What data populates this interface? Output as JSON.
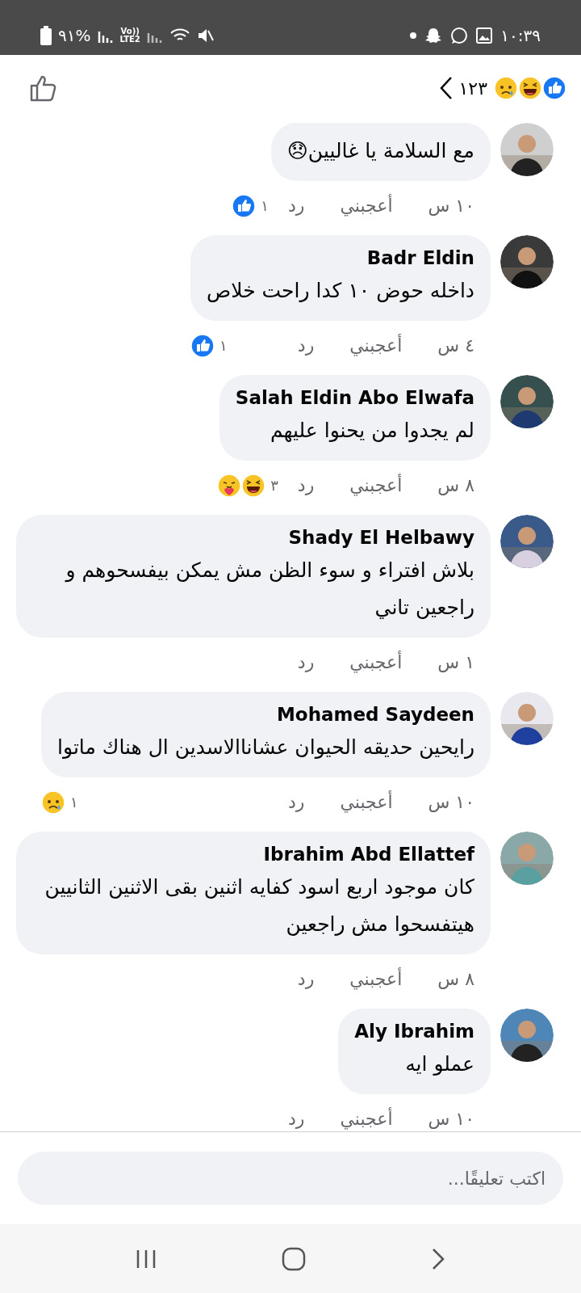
{
  "status_bar": {
    "time": "١٠:٣٩",
    "battery": "%٩١",
    "network_top": "Vo))",
    "network_bottom": "LTE2"
  },
  "header": {
    "reactions": [
      {
        "kind": "like"
      },
      {
        "kind": "haha"
      },
      {
        "kind": "sad"
      }
    ],
    "count": "١٢٣"
  },
  "comments": [
    {
      "text": "مع السلامة يا غاليين😞",
      "time": "١٠ س",
      "like": "أعجبني",
      "reply": "رد",
      "reactions": [
        {
          "kind": "like"
        }
      ],
      "reaction_count": "١"
    },
    {
      "name": "Badr Eldin",
      "text": "داخله حوض ١٠ كدا راحت خلاص",
      "time": "٤ س",
      "like": "أعجبني",
      "reply": "رد",
      "reactions": [
        {
          "kind": "like"
        }
      ],
      "reaction_count": "١"
    },
    {
      "name": "Salah Eldin Abo Elwafa",
      "text": "لم يجدوا من يحنوا عليهم",
      "time": "٨ س",
      "like": "أعجبني",
      "reply": "رد",
      "reactions": [
        {
          "kind": "haha"
        },
        {
          "kind": "care"
        }
      ],
      "reaction_count": "٣"
    },
    {
      "name": "Shady El Helbawy",
      "text": "بلاش افتراء و سوء الظن مش يمكن بيفسحوهم و راجعين  تاني",
      "time": "١ س",
      "like": "أعجبني",
      "reply": "رد"
    },
    {
      "name": "Mohamed Saydeen",
      "text": "رايحين حديقه الحيوان عشاناالاسدين ال هناك ماتوا",
      "time": "١٠ س",
      "like": "أعجبني",
      "reply": "رد",
      "reactions": [
        {
          "kind": "sad"
        }
      ],
      "reaction_count": "١"
    },
    {
      "name": "Ibrahim Abd Ellattef",
      "text": "كان موجود اربع اسود كفايه اثنين بقى الاثنين الثانيين هيتفسحوا مش راجعين",
      "time": "٨ س",
      "like": "أعجبني",
      "reply": "رد"
    },
    {
      "name": "Aly Ibrahim",
      "text": "عملو ايه",
      "time": "١٠ س",
      "like": "أعجبني",
      "reply": "رد"
    }
  ],
  "composer": {
    "placeholder": "اكتب تعليقًا..."
  }
}
